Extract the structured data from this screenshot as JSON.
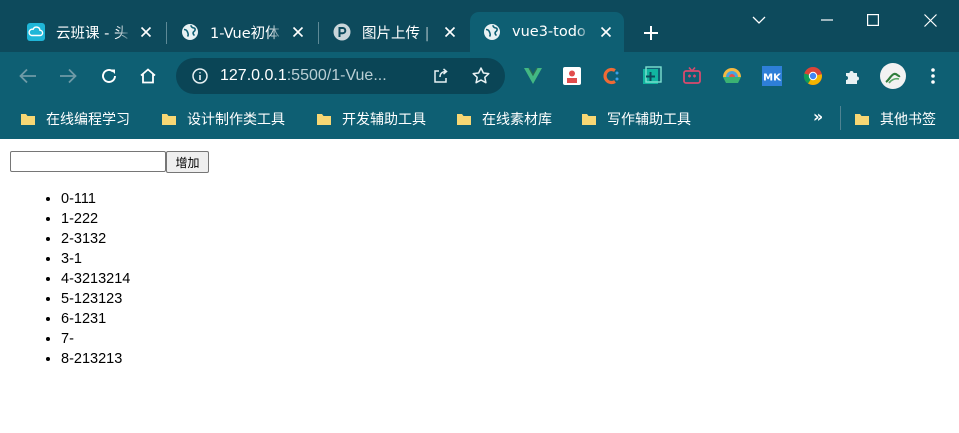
{
  "tabs": [
    {
      "title": "云班课 - 头",
      "icon": "cloud-class-icon",
      "active": false
    },
    {
      "title": "1-Vue初体",
      "icon": "globe-icon",
      "active": false
    },
    {
      "title": "图片上传 | ",
      "icon": "p-logo-icon",
      "active": false
    },
    {
      "title": "vue3-todo",
      "icon": "globe-icon",
      "active": true
    }
  ],
  "address_bar": {
    "host": "127.0.0.1",
    "path": ":5500/1-Vue..."
  },
  "bookmarks": {
    "items": [
      {
        "label": "在线编程学习"
      },
      {
        "label": "设计制作类工具"
      },
      {
        "label": "开发辅助工具"
      },
      {
        "label": "在线素材库"
      },
      {
        "label": "写作辅助工具"
      }
    ],
    "other": "其他书签"
  },
  "todo": {
    "input_value": "",
    "add_button_label": "增加",
    "items": [
      "0-111",
      "1-222",
      "2-3132",
      "3-1",
      "4-3213214",
      "5-123123",
      "6-1231",
      "7-",
      "8-213213"
    ]
  },
  "colors": {
    "tabstrip": "#0d4a5c",
    "toolbar": "#0e5f73",
    "omnibox": "#0a4556"
  }
}
